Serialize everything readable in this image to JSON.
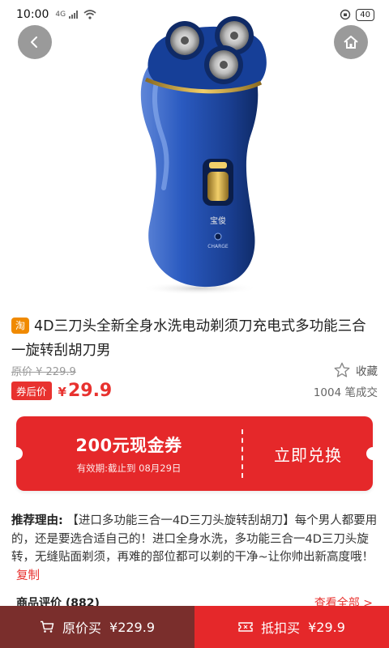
{
  "status_bar": {
    "time": "10:00",
    "signal_text": "4G",
    "battery": "40"
  },
  "nav": {
    "back_icon": "chevron-left-icon",
    "home_icon": "home-icon"
  },
  "product": {
    "image_icon": "electric-shaver-image",
    "brand_logo": "宝俊",
    "charge_text": "CHARGE",
    "badge": "淘",
    "title": "4D三刀头全新全身水洗电动剃须刀充电式多功能三合一旋转刮胡刀男",
    "original_price": "原价 ¥ 229.9",
    "favorite_label": "收藏",
    "coupon_price_tag": "券后价",
    "currency": "¥",
    "price_after_coupon": "29.9",
    "sold_count": "1004 笔成交"
  },
  "coupon": {
    "amount": "200元现金券",
    "validity": "有效期:截止到 08月29日",
    "action": "立即兑换"
  },
  "recommendation": {
    "label": "推荐理由:",
    "text": "【进口多功能三合一4D三刀头旋转刮胡刀】每个男人都要用的，还是要选合适自己的！进口全身水洗，多功能三合一4D三刀头旋转，无缝贴面剃须，再难的部位都可以剃的干净~让你帅出新高度哦！",
    "copy": "复制"
  },
  "reviews": {
    "title": "商品评价 (882)",
    "more": "查看全部 >"
  },
  "bottom_bar": {
    "buy_original_label": "原价买",
    "buy_original_price": "¥229.9",
    "buy_coupon_label": "抵扣买",
    "buy_coupon_price": "¥29.9"
  },
  "colors": {
    "accent_red": "#e5282a",
    "dark_red": "#7a2e2c",
    "shaver_blue": "#1f4fa8"
  }
}
